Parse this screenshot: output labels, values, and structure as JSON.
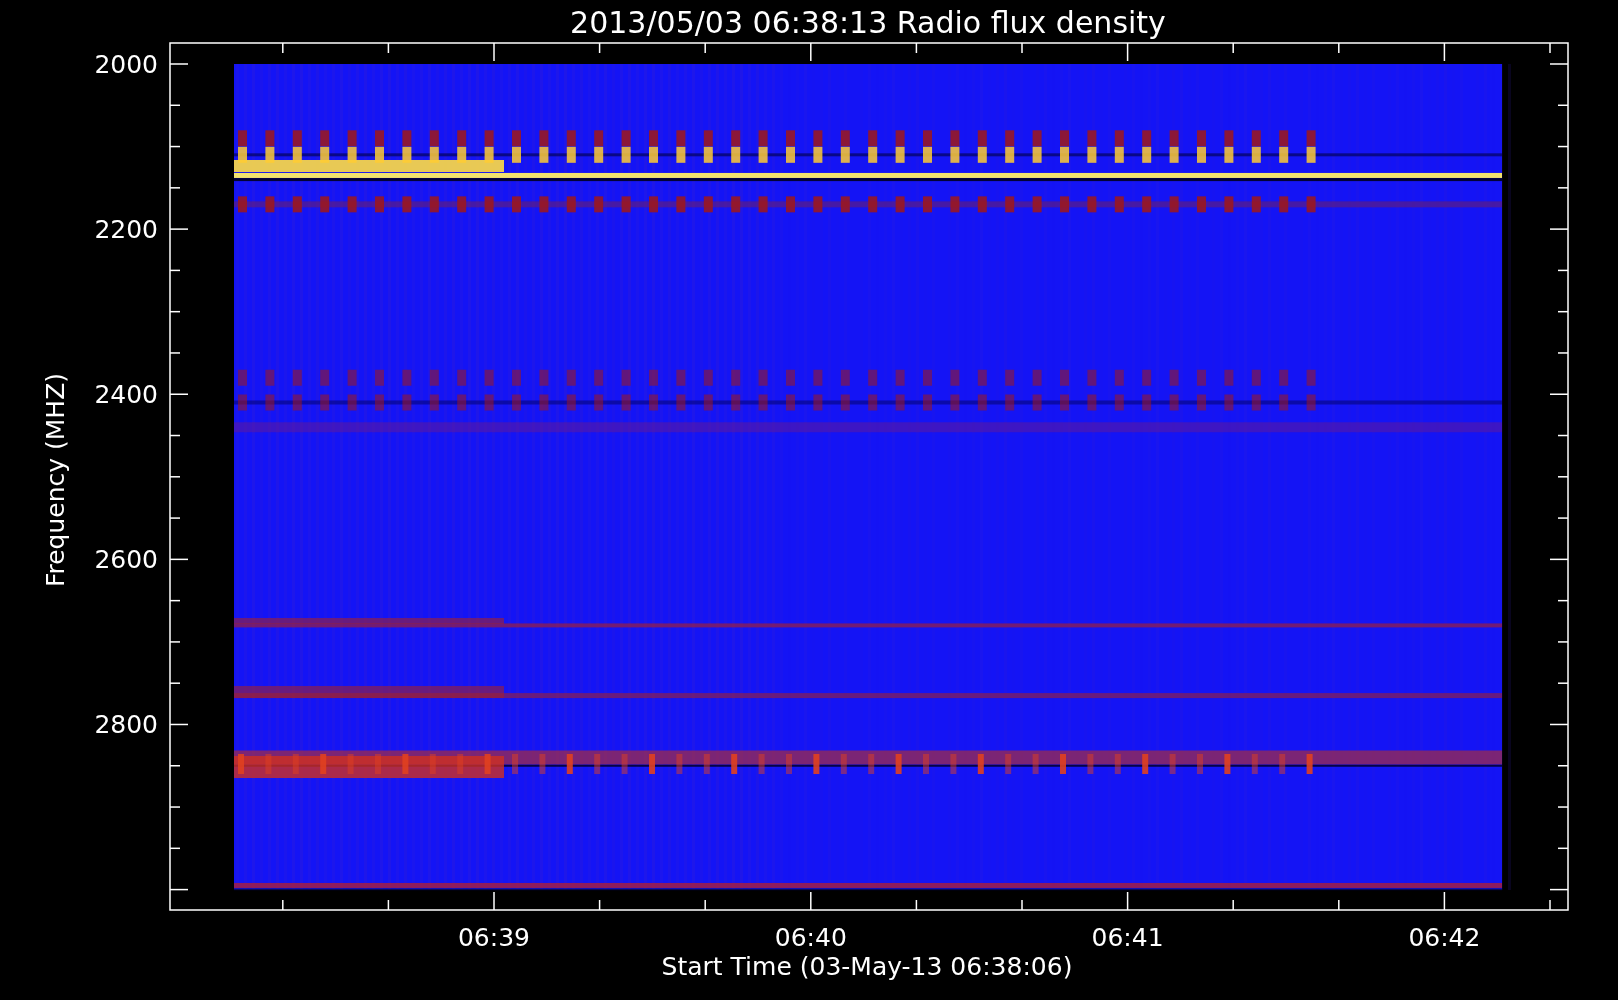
{
  "title": "2013/05/03 06:38:13 Radio flux density",
  "y_axis": {
    "label": "Frequency (MHZ)",
    "ticks": [
      "2000",
      "2200",
      "2400",
      "2600",
      "2800"
    ]
  },
  "x_axis": {
    "label": "Start Time (03-May-13 06:38:06)",
    "ticks": [
      "06:39",
      "06:40",
      "06:41",
      "06:42"
    ]
  }
}
